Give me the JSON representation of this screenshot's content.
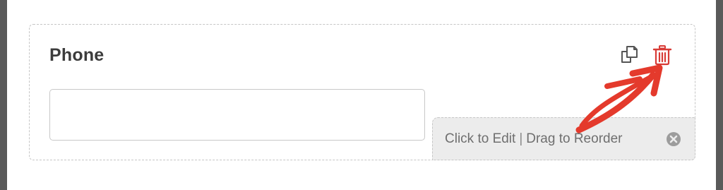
{
  "field": {
    "label": "Phone",
    "input_value": "",
    "input_placeholder": ""
  },
  "actions": {
    "duplicate_icon": "duplicate-icon",
    "delete_icon": "trash-icon",
    "delete_color": "#d83b36"
  },
  "edit_bar": {
    "click_label": "Click to Edit",
    "separator": "|",
    "drag_label": "Drag to Reorder",
    "close_icon": "close-circle-icon"
  },
  "annotation": {
    "arrow_color": "#e43a2c"
  }
}
